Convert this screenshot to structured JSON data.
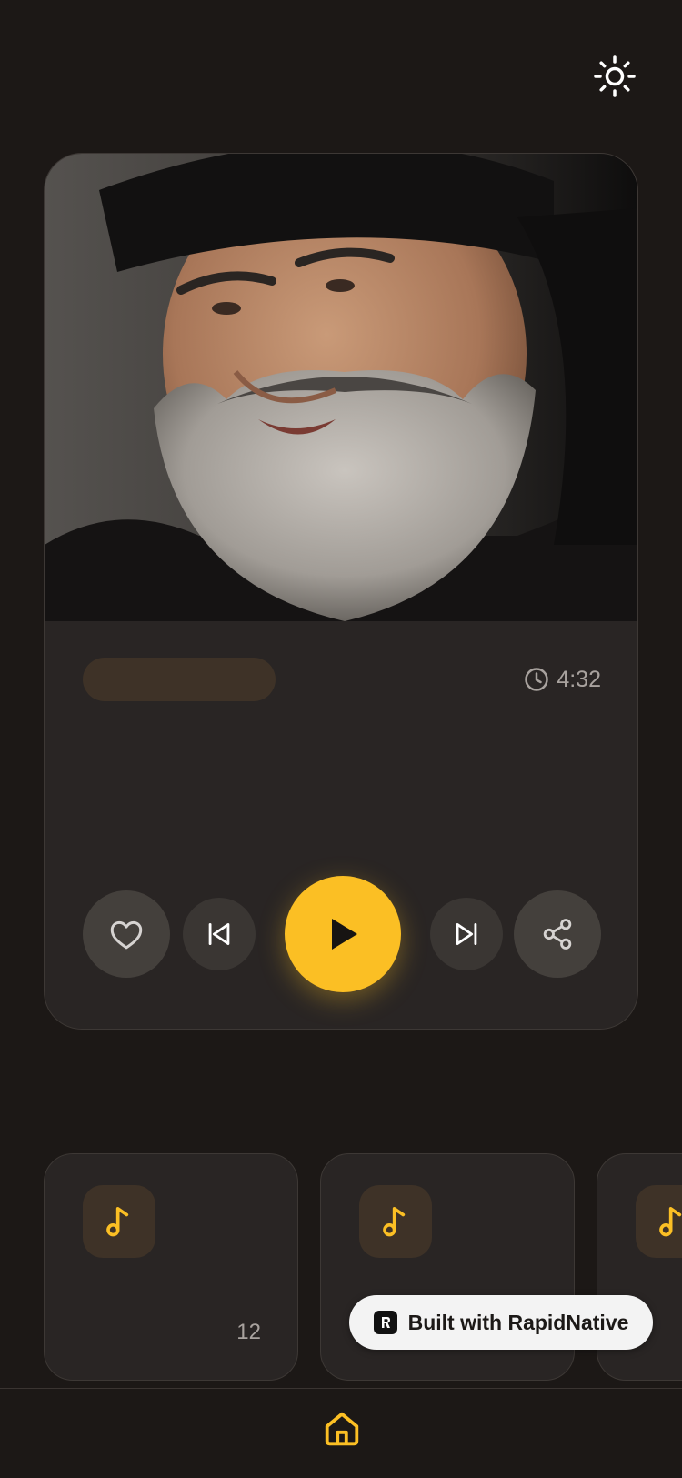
{
  "header": {
    "theme_toggle_icon": "sun-icon"
  },
  "player": {
    "artwork_alt": "Album artwork portrait",
    "duration": "4:32",
    "duration_icon": "clock-icon",
    "controls": {
      "favorite_icon": "heart-icon",
      "previous_icon": "skip-back-icon",
      "play_icon": "play-icon",
      "next_icon": "skip-forward-icon",
      "share_icon": "share-icon"
    }
  },
  "tracks": {
    "cards": [
      {
        "icon": "music-note-icon",
        "count": "12"
      },
      {
        "icon": "music-note-icon",
        "count": ""
      },
      {
        "icon": "music-note-icon",
        "count": ""
      }
    ]
  },
  "badge": {
    "label": "Built with RapidNative",
    "logo": "rapidnative-logo"
  },
  "tabbar": {
    "home_icon": "home-icon"
  },
  "colors": {
    "background": "#1c1816",
    "card": "#292524",
    "accent": "#fbbf24",
    "muted_text": "#a8a29e"
  }
}
